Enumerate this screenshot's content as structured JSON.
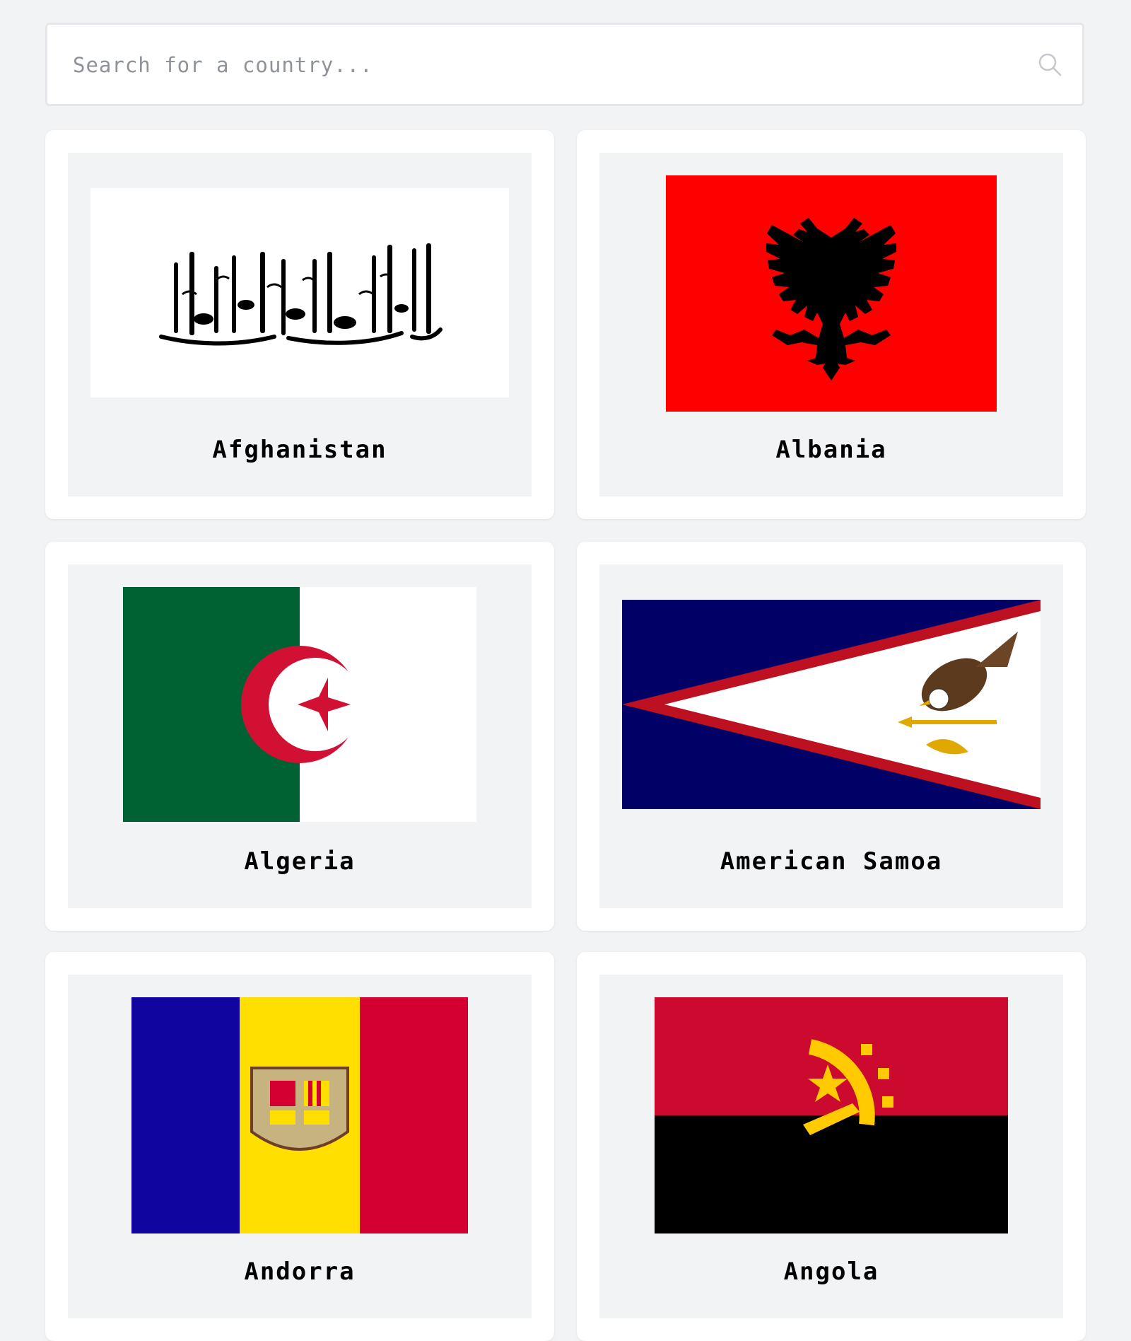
{
  "search": {
    "placeholder": "Search for a country...",
    "icon": "search-icon"
  },
  "countries": [
    {
      "name": "Afghanistan",
      "flag_colors": [
        "#ffffff",
        "#000000"
      ]
    },
    {
      "name": "Albania",
      "flag_colors": [
        "#ff0000",
        "#000000"
      ]
    },
    {
      "name": "Algeria",
      "flag_colors": [
        "#006233",
        "#ffffff",
        "#d21034"
      ]
    },
    {
      "name": "American Samoa",
      "flag_colors": [
        "#000066",
        "#ffffff",
        "#bd1021"
      ]
    },
    {
      "name": "Andorra",
      "flag_colors": [
        "#10069f",
        "#fedf00",
        "#d50032"
      ]
    },
    {
      "name": "Angola",
      "flag_colors": [
        "#cc092f",
        "#000000",
        "#ffcb00"
      ]
    }
  ]
}
